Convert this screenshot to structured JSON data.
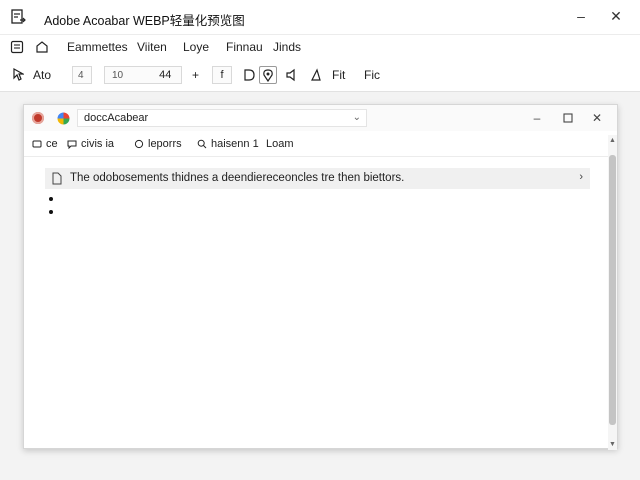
{
  "app": {
    "title": "Adobe Acoabar  WEBP轻量化预览图",
    "icon": "document-icon"
  },
  "window_controls": {
    "minimize": "–",
    "close": "✕"
  },
  "menu": {
    "items": [
      {
        "label": "Eammettes"
      },
      {
        "label": "Viiten"
      },
      {
        "label": "Loye"
      },
      {
        "label": "Finnau"
      },
      {
        "label": "Jinds"
      }
    ]
  },
  "toolbar": {
    "ato_label": "Ato",
    "page_box_value": "4",
    "page_field_left": "10",
    "page_field_right": "44",
    "plus_label": "+",
    "f_label": "f",
    "fit_label": "Fit",
    "fic_label": "Fic"
  },
  "inner": {
    "address": "doccAcabear",
    "toolbar": {
      "item1": "ce",
      "item2": "civis  ia",
      "item3": "leporrs",
      "item4": "haisenn 1",
      "item5": "Loam"
    },
    "notice_text": "The odobosements thidnes a deendiereceoncles tre then biettors.",
    "bullets": [
      "",
      ""
    ]
  },
  "colors": {
    "accent_red": "#c0392b",
    "scroll_thumb": "#c4c4c4",
    "notice_bg": "#f0f0f0"
  }
}
